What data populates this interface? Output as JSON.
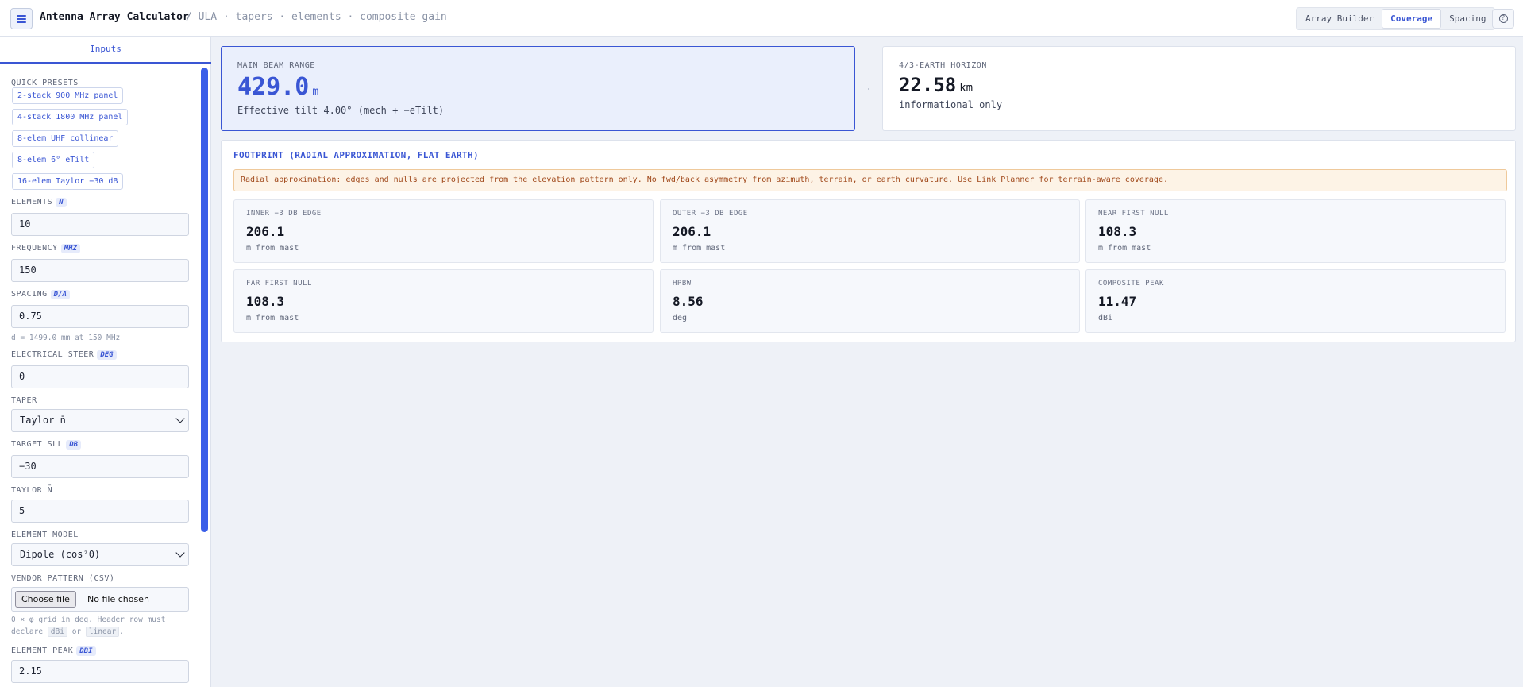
{
  "header": {
    "app_title": "Antenna Array Calculator",
    "breadcrumb": "/ ULA · tapers · elements · composite gain",
    "tabs": [
      {
        "label": "Array Builder",
        "active": false
      },
      {
        "label": "Coverage",
        "active": true
      },
      {
        "label": "Spacing",
        "active": false
      }
    ],
    "menu_icon": "hamburger-menu-icon",
    "help_icon": "help-icon"
  },
  "sidebar": {
    "tab_label": "Inputs",
    "quick_presets_label": "QUICK PRESETS",
    "presets": [
      "2-stack 900 MHz panel",
      "4-stack 1800 MHz panel",
      "8-elem UHF collinear",
      "8-elem 6° eTilt",
      "16-elem Taylor −30 dB"
    ],
    "elements": {
      "label": "ELEMENTS",
      "unit": "N",
      "value": "10"
    },
    "frequency": {
      "label": "FREQUENCY",
      "unit": "MHZ",
      "value": "150"
    },
    "spacing": {
      "label": "SPACING",
      "unit": "D/Λ",
      "value": "0.75",
      "hint": "d = 1499.0 mm at 150 MHz"
    },
    "steer": {
      "label": "ELECTRICAL STEER",
      "unit": "DEG",
      "value": "0"
    },
    "taper": {
      "label": "TAPER",
      "value": "Taylor n̄"
    },
    "target_sll": {
      "label": "TARGET SLL",
      "unit": "DB",
      "value": "−30"
    },
    "taylor_n": {
      "label": "TAYLOR N̄",
      "value": "5"
    },
    "element_model": {
      "label": "ELEMENT MODEL",
      "value": "Dipole (cos²θ)"
    },
    "vendor_pattern": {
      "label": "VENDOR PATTERN (CSV)",
      "button": "Choose file",
      "status": "No file chosen",
      "hint_prefix": "θ × φ grid in deg. Header row must",
      "hint_declare": "declare",
      "hint_code1": "dBi",
      "hint_or": "or",
      "hint_code2": "linear",
      "hint_end": "."
    },
    "element_peak": {
      "label": "ELEMENT PEAK",
      "unit": "DBI",
      "value": "2.15"
    }
  },
  "main": {
    "beam_range": {
      "label": "MAIN BEAM RANGE",
      "value": "429.0",
      "unit": "m",
      "sub": "Effective tilt 4.00° (mech + −eTilt)"
    },
    "horizon": {
      "label": "4/3-EARTH HORIZON",
      "value": "22.58",
      "unit": "km",
      "sub": "informational only"
    },
    "footprint": {
      "title": "FOOTPRINT (RADIAL APPROXIMATION, FLAT EARTH)",
      "warning": "Radial approximation: edges and nulls are projected from the elevation pattern only. No fwd/back asymmetry from azimuth, terrain, or earth curvature. Use Link Planner for terrain-aware coverage.",
      "metrics": [
        {
          "label": "INNER −3 DB EDGE",
          "value": "206.1",
          "unit": "m from mast"
        },
        {
          "label": "OUTER −3 DB EDGE",
          "value": "206.1",
          "unit": "m from mast"
        },
        {
          "label": "NEAR FIRST NULL",
          "value": "108.3",
          "unit": "m from mast"
        },
        {
          "label": "FAR FIRST NULL",
          "value": "108.3",
          "unit": "m from mast"
        },
        {
          "label": "HPBW",
          "value": "8.56",
          "unit": "deg"
        },
        {
          "label": "COMPOSITE PEAK",
          "value": "11.47",
          "unit": "dBi"
        }
      ]
    }
  }
}
